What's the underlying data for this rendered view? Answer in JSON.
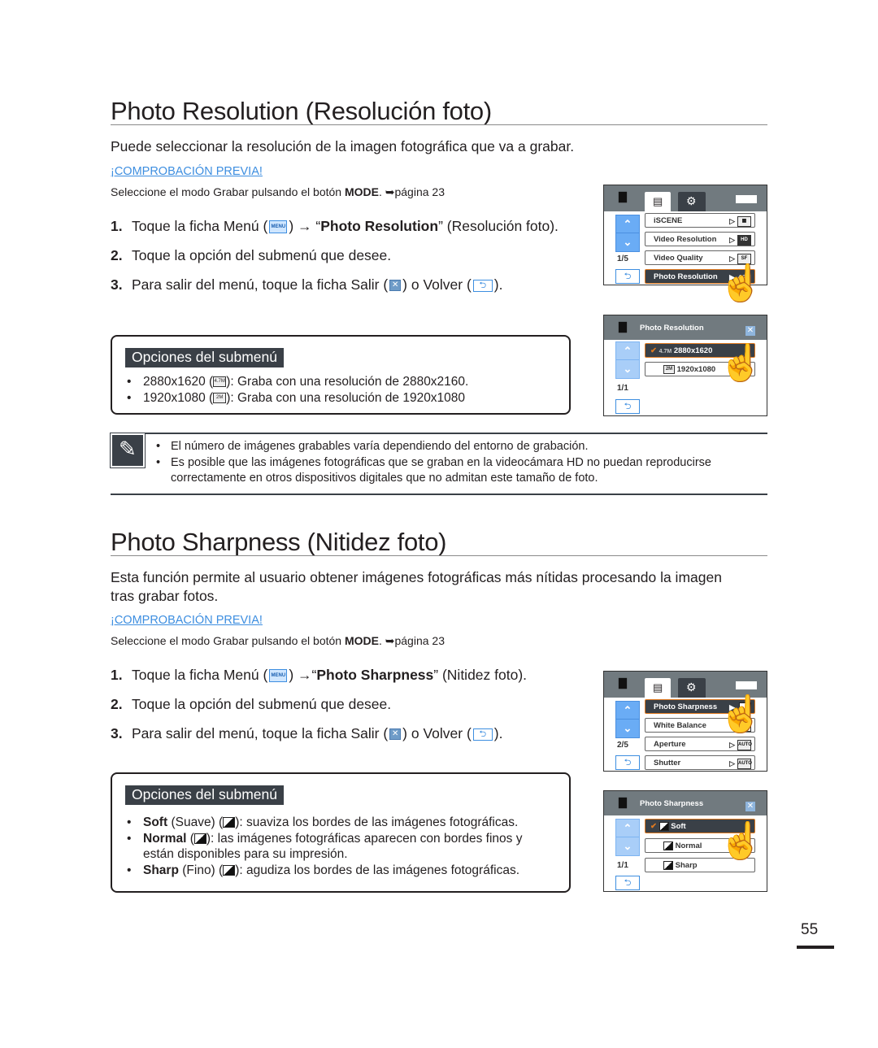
{
  "section1": {
    "title": "Photo Resolution (Resolución foto)",
    "intro": "Puede seleccionar la resolución de la imagen fotográfica que va a grabar.",
    "precheck_label": "¡COMPROBACIÓN PREVIA!",
    "precheck_text_before": "Seleccione el modo Grabar pulsando el botón ",
    "precheck_mode": "MODE",
    "precheck_text_after": ". ➥página 23",
    "steps": [
      {
        "num": "1.",
        "text_before": "Toque la ficha Menú (",
        "icon": "MENU",
        "text_mid": ") → “",
        "bold": "Photo Resolution",
        "text_after": "” (Resolución foto)."
      },
      {
        "num": "2.",
        "text": "Toque la opción del submenú que desee."
      },
      {
        "num": "3.",
        "text_before": "Para salir del menú, toque la ficha Salir (",
        "text_mid": ") o Volver (",
        "text_after": ")."
      }
    ],
    "submenu": {
      "title": "Opciones del submenú",
      "items": [
        {
          "label": "2880x1620",
          "icon": "4.7M",
          "desc": ": Graba con una resolución de 2880x2160."
        },
        {
          "label": "1920x1080",
          "icon": "2M",
          "desc": ": Graba con una resolución de 1920x1080"
        }
      ]
    },
    "screen_menu": {
      "page": "1/5",
      "items": [
        {
          "label": "iSCENE",
          "icon": "scene"
        },
        {
          "label": "Video Resolution",
          "icon": "HD"
        },
        {
          "label": "Video Quality",
          "icon": "SF"
        },
        {
          "label": "Photo Resolution",
          "icon": "4.7M",
          "selected": true
        }
      ]
    },
    "screen_sub": {
      "title": "Photo Resolution",
      "page": "1/1",
      "items": [
        {
          "label": "2880x1620",
          "icon": "4.7M",
          "selected": true
        },
        {
          "label": "1920x1080",
          "icon": "2M"
        }
      ]
    }
  },
  "notes": [
    "El número de imágenes grabables varía dependiendo del entorno de grabación.",
    "Es posible que las imágenes fotográficas que se graban en la videocámara HD no puedan reproducirse correctamente en otros dispositivos digitales que no admitan este tamaño de foto."
  ],
  "section2": {
    "title": "Photo Sharpness (Nitidez foto)",
    "intro": "Esta función permite al usuario obtener imágenes fotográficas más nítidas procesando la imagen tras grabar fotos.",
    "precheck_label": "¡COMPROBACIÓN PREVIA!",
    "precheck_text_before": "Seleccione el modo Grabar pulsando el botón ",
    "precheck_mode": "MODE",
    "precheck_text_after": ". ➥página 23",
    "steps": [
      {
        "num": "1.",
        "text_before": "Toque la ficha Menú (",
        "icon": "MENU",
        "text_mid": ") →“",
        "bold": "Photo Sharpness",
        "text_after": "” (Nitidez foto)."
      },
      {
        "num": "2.",
        "text": "Toque la opción del submenú que desee."
      },
      {
        "num": "3.",
        "text_before": "Para salir del menú, toque la ficha Salir (",
        "text_mid": ") o Volver (",
        "text_after": ")."
      }
    ],
    "submenu": {
      "title": "Opciones del submenú",
      "items": [
        {
          "bold": "Soft",
          "paren": " (Suave) (",
          "desc": "): suaviza los bordes de las imágenes fotográficas."
        },
        {
          "bold": "Normal",
          "paren": " (",
          "desc": "): las imágenes fotográficas aparecen con bordes finos y están disponibles para su impresión."
        },
        {
          "bold": "Sharp",
          "paren": " (Fino) (",
          "desc": "): agudiza los bordes de las imágenes fotográficas."
        }
      ]
    },
    "screen_menu": {
      "page": "2/5",
      "items": [
        {
          "label": "Photo Sharpness",
          "icon": "sharp",
          "selected": true
        },
        {
          "label": "White Balance",
          "icon": "AWB"
        },
        {
          "label": "Aperture",
          "icon": "AUTO"
        },
        {
          "label": "Shutter",
          "icon": "AUTO"
        }
      ]
    },
    "screen_sub": {
      "title": "Photo Sharpness",
      "page": "1/1",
      "items": [
        {
          "label": "Soft",
          "selected": true
        },
        {
          "label": "Normal"
        },
        {
          "label": "Sharp"
        }
      ]
    }
  },
  "icons": {
    "up": "⌃",
    "down": "⌄",
    "back": "⮌",
    "close": "✕",
    "check": "✔",
    "play": "▷",
    "play_filled": "▶",
    "camera": "▇",
    "menu_tab": "▤",
    "settings_tab": "⚙",
    "hand": "☝",
    "note": "✎"
  },
  "page_number": "55"
}
